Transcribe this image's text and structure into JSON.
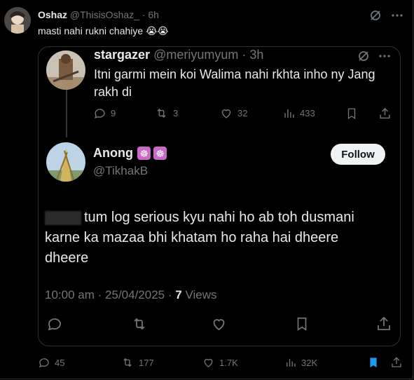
{
  "outer_tweet": {
    "name": "Oshaz",
    "handle": "@ThisisOshaz_",
    "time": "6h",
    "text": "masti nahi rukni chahiye 😭😭",
    "actions": {
      "replies": "45",
      "reposts": "177",
      "likes": "1.7K",
      "views": "32K"
    }
  },
  "quoted_parent": {
    "name": "stargazer",
    "handle": "@meriyumyum",
    "time": "3h",
    "text": "Itni garmi mein koi Walima nahi rkhta inho ny Jang rakh di",
    "actions": {
      "replies": "9",
      "reposts": "3",
      "likes": "32",
      "views": "433"
    }
  },
  "quoted_reply": {
    "name": "Anong",
    "badges": [
      "☸",
      "☸"
    ],
    "handle": "@TikhakB",
    "follow_label": "Follow",
    "text": "tum log serious kyu nahi ho ab toh dusmani karne ka mazaa bhi khatam ho raha hai dheere dheere",
    "time": "10:00 am",
    "date": "25/04/2025",
    "views_count": "7",
    "views_label": "Views"
  },
  "colors": {
    "bookmark_active": "#1d9bf0",
    "badge": "#c86ac6"
  }
}
